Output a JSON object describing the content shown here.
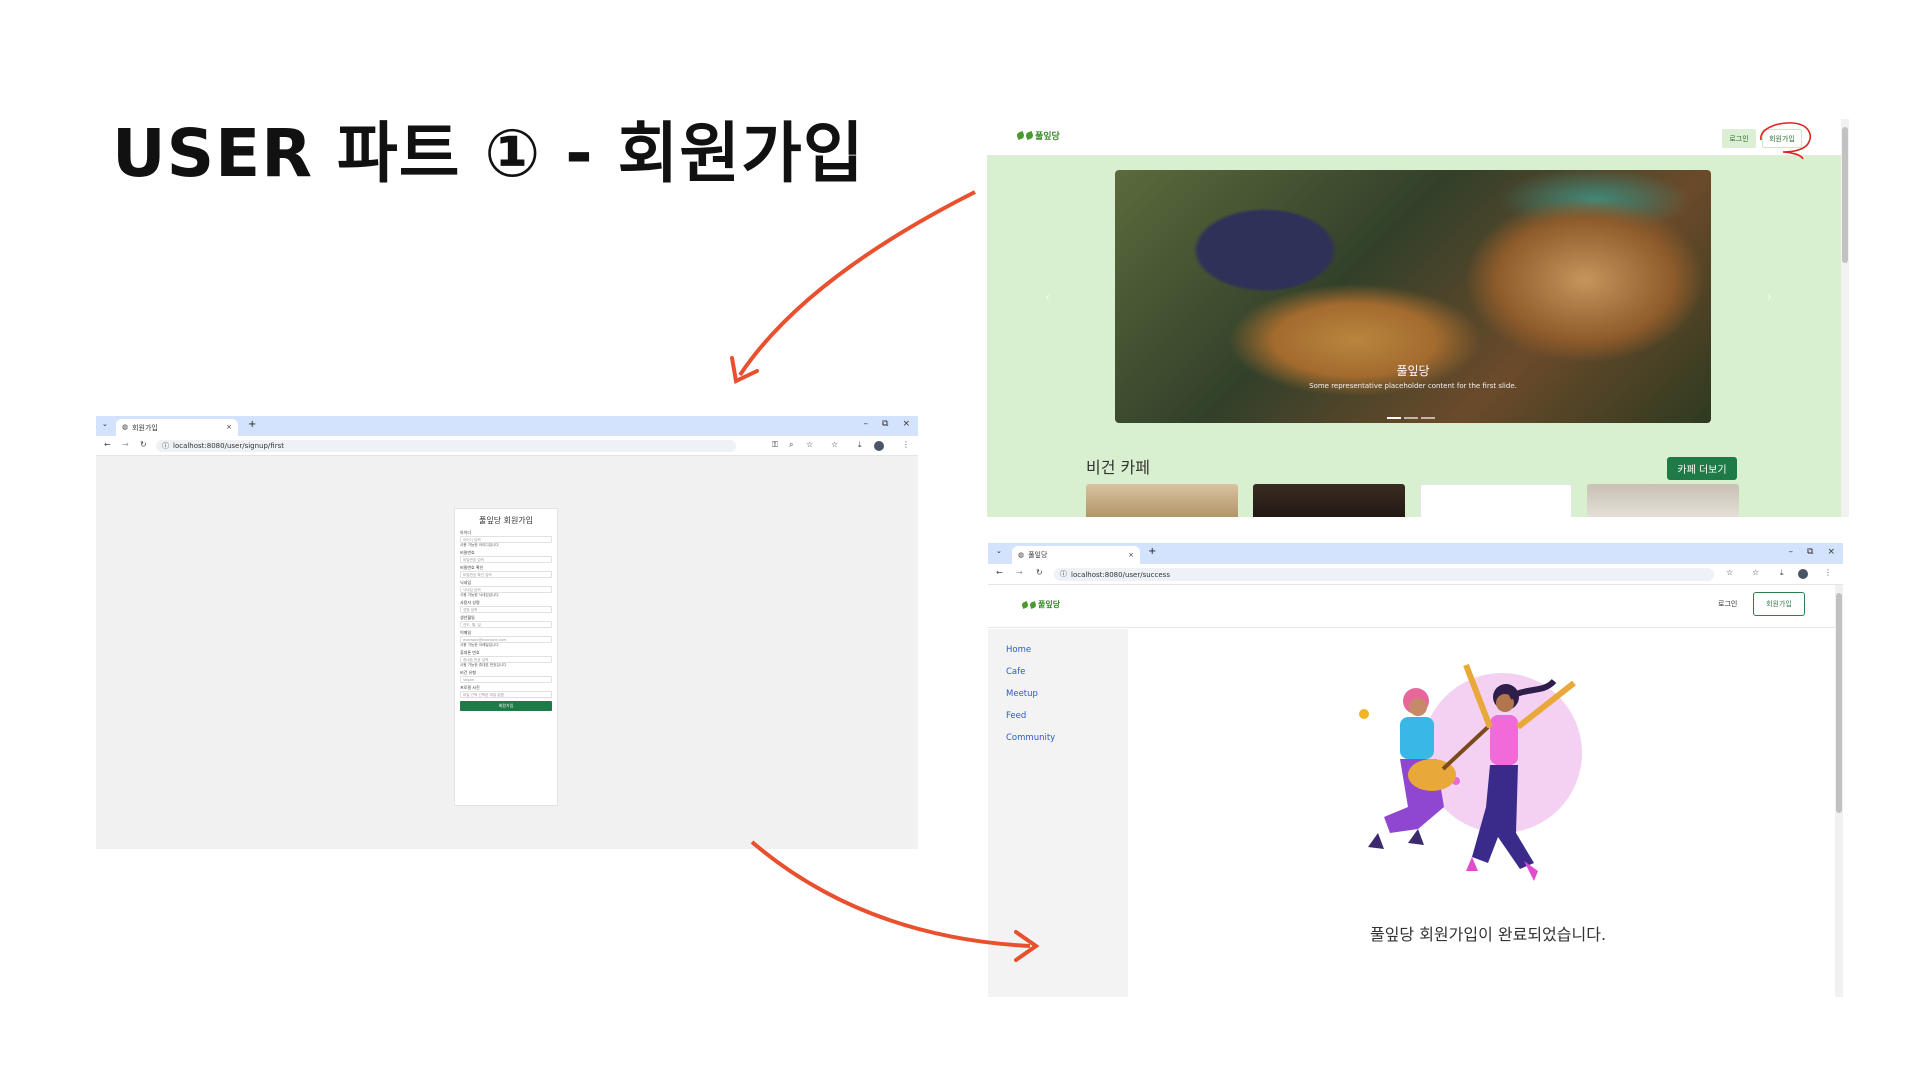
{
  "slide": {
    "title": "USER 파트 ① - 회원가입"
  },
  "colors": {
    "accent_green": "#1e7a46",
    "arrow_red": "#e8502e",
    "page_green": "#d9f0d0"
  },
  "signup_shot": {
    "tab_title": "회원가입",
    "url": "localhost:8080/user/signup/first",
    "form": {
      "title": "풀잎당 회원가입",
      "fields": [
        {
          "label": "아이디",
          "placeholder": "아이디 입력",
          "hint": "사용 가능한 아이디입니다"
        },
        {
          "label": "비밀번호",
          "placeholder": "비밀번호 입력",
          "hint": ""
        },
        {
          "label": "비밀번호 확인",
          "placeholder": "비밀번호 확인 입력",
          "hint": ""
        },
        {
          "label": "닉네임",
          "placeholder": "닉네임 입력",
          "hint": "사용 가능한 닉네임입니다"
        },
        {
          "label": "사용자 성명",
          "placeholder": "성명 입력",
          "hint": ""
        },
        {
          "label": "생년월일",
          "placeholder": "연도. 월. 일.",
          "hint": ""
        },
        {
          "label": "이메일",
          "placeholder": "example@example.com",
          "hint": "사용 가능한 이메일입니다"
        },
        {
          "label": "휴대폰 번호",
          "placeholder": "휴대폰 번호 입력",
          "hint": "사용 가능한 휴대폰 번호입니다"
        },
        {
          "label": "비건 유형",
          "placeholder": "Vegan",
          "hint": ""
        },
        {
          "label": "프로필 사진",
          "placeholder": "파일 선택   선택된 파일 없음",
          "hint": ""
        }
      ],
      "submit_label": "회원가입"
    }
  },
  "main_shot": {
    "logo_text": "풀잎당",
    "login_label": "로그인",
    "signup_label": "회원가입",
    "carousel": {
      "caption_title": "풀잎당",
      "caption_text": "Some representative placeholder content for the first slide."
    },
    "section_title": "비건 카페",
    "more_button": "카페 더보기"
  },
  "success_shot": {
    "tab_title": "풀잎당",
    "url": "localhost:8080/user/success",
    "logo_text": "풀잎당",
    "login_label": "로그인",
    "signup_label": "회원가입",
    "sidebar": [
      {
        "label": "Home"
      },
      {
        "label": "Cafe"
      },
      {
        "label": "Meetup"
      },
      {
        "label": "Feed"
      },
      {
        "label": "Community"
      }
    ],
    "message": "풀잎당 회원가입이 완료되었습니다."
  }
}
